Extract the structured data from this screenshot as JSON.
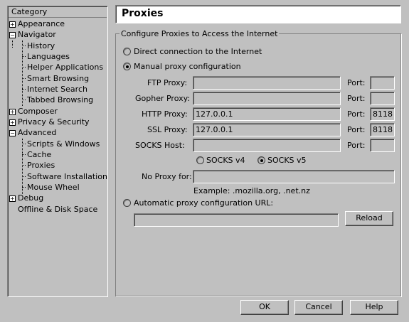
{
  "tree": {
    "header": "Category",
    "items": [
      {
        "label": "Appearance",
        "expander": "+"
      },
      {
        "label": "Navigator",
        "expander": "−"
      },
      {
        "label": "History"
      },
      {
        "label": "Languages"
      },
      {
        "label": "Helper Applications"
      },
      {
        "label": "Smart Browsing"
      },
      {
        "label": "Internet Search"
      },
      {
        "label": "Tabbed Browsing"
      },
      {
        "label": "Composer",
        "expander": "+"
      },
      {
        "label": "Privacy & Security",
        "expander": "+"
      },
      {
        "label": "Advanced",
        "expander": "−"
      },
      {
        "label": "Scripts & Windows"
      },
      {
        "label": "Cache"
      },
      {
        "label": "Proxies"
      },
      {
        "label": "Software Installation"
      },
      {
        "label": "Mouse Wheel"
      },
      {
        "label": "Debug",
        "expander": "+"
      },
      {
        "label": "Offline & Disk Space"
      }
    ]
  },
  "panel": {
    "title": "Proxies",
    "group_legend": "Configure Proxies to Access the Internet",
    "direct_label": "Direct connection to the Internet",
    "manual_label": "Manual proxy configuration",
    "ftp_label": "FTP Proxy:",
    "gopher_label": "Gopher Proxy:",
    "http_label": "HTTP Proxy:",
    "ssl_label": "SSL Proxy:",
    "socks_label": "SOCKS Host:",
    "port_label": "Port:",
    "ftp_value": "",
    "gopher_value": "",
    "http_value": "127.0.0.1",
    "ssl_value": "127.0.0.1",
    "socks_value": "",
    "ftp_port": "",
    "gopher_port": "",
    "http_port": "8118",
    "ssl_port": "8118",
    "socks_port": "",
    "socks_v4_label": "SOCKS v4",
    "socks_v5_label": "SOCKS v5",
    "noproxy_label": "No Proxy for:",
    "noproxy_value": "",
    "example_text": "Example: .mozilla.org, .net.nz",
    "auto_label": "Automatic proxy configuration URL:",
    "auto_value": "",
    "reload_label": "Reload"
  },
  "footer": {
    "ok_label": "OK",
    "cancel_label": "Cancel",
    "help_label": "Help"
  }
}
